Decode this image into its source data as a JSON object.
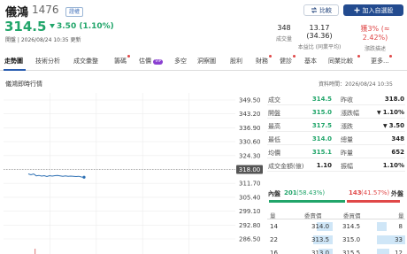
{
  "header": {
    "name": "儀鴻",
    "code": "1476",
    "market_badge": "證權",
    "price": "314.5",
    "change": "3.50 (1.10%)",
    "open_status": "開盤 | 2026/08/24 10:35 更新",
    "stats": [
      {
        "value": "348",
        "label": "成交量"
      },
      {
        "value": "13.17 (34.36)",
        "label": "本益比 (同業平均)"
      },
      {
        "value": "獲3% (≈ 2.42%)",
        "label": "漲跌描述"
      }
    ],
    "compare_label": "比較",
    "watch_label": "加入自選股",
    "colors": {
      "down": "#21a56a",
      "up": "#e04848",
      "brand": "#234b8f"
    }
  },
  "tabs": [
    "走勢圖",
    "技術分析",
    "成交彙整",
    "籌碼",
    "估價",
    "多空",
    "洞察圖",
    "股利",
    "財務",
    "健診",
    "基本",
    "同業比較",
    "更多..."
  ],
  "tab_vip_label": "VIP",
  "active_tab": "走勢圖",
  "section": {
    "title": "儀鴻即時行情",
    "data_time": "資料時間：2026/08/24 10:35"
  },
  "chart_data": {
    "type": "line",
    "title": "",
    "y_ticks": [
      349.5,
      343.2,
      336.9,
      330.6,
      324.3,
      318.0,
      311.7,
      305.4,
      299.1,
      292.8,
      286.5
    ],
    "ylim": [
      286.5,
      349.5
    ],
    "reference_price": 318.0,
    "reference_label": "318.00",
    "series": [
      {
        "values": [
          316.0,
          315.6,
          316.0,
          315.1,
          315.3,
          315.0,
          315.2,
          314.8,
          315.2,
          315.0,
          315.2,
          315.3,
          315.1,
          314.9,
          315.1,
          314.9,
          315.0,
          314.9,
          314.8,
          314.9,
          314.6,
          314.5
        ]
      }
    ],
    "volume_bar": {
      "index": 3,
      "value": 0.12
    },
    "grid": true
  },
  "stats_table": [
    {
      "k": "成交",
      "v": "314.5",
      "vc": "g",
      "k2": "昨收",
      "v2": "318.0",
      "v2c": "dk"
    },
    {
      "k": "開盤",
      "v": "315.0",
      "vc": "g",
      "k2": "漲跌幅",
      "v2": "1.10%",
      "v2c": "g",
      "arrow2": "down"
    },
    {
      "k": "最高",
      "v": "317.5",
      "vc": "g",
      "k2": "漲跌",
      "v2": "3.50",
      "v2c": "g",
      "arrow2": "down"
    },
    {
      "k": "最低",
      "v": "314.0",
      "vc": "g",
      "k2": "總量",
      "v2": "348",
      "v2c": "dk"
    },
    {
      "k": "均價",
      "v": "315.1",
      "vc": "g",
      "k2": "昨量",
      "v2": "652",
      "v2c": "dk"
    },
    {
      "k": "成交金額(億)",
      "v": "1.10",
      "vc": "dk",
      "k2": "振幅",
      "v2": "1.10%",
      "v2c": "dk"
    }
  ],
  "order_book": {
    "inner_label": "內盤",
    "inner_value": "201",
    "inner_pct": "(58.43%)",
    "inner_ratio": 0.5843,
    "outer_value": "143",
    "outer_pct": "(41.57%)",
    "outer_label": "外盤",
    "headers": [
      "量",
      "委賣價",
      "委買價",
      "量"
    ],
    "rows": [
      {
        "bid_qty": "14",
        "bid_price": "314.0",
        "ask_price": "314.5",
        "ask_qty": "8",
        "bid_level": 0.55,
        "ask_level": 0.35
      },
      {
        "bid_qty": "22",
        "bid_price": "313.5",
        "ask_price": "315.0",
        "ask_qty": "33",
        "bid_level": 0.7,
        "ask_level": 1.0
      },
      {
        "bid_qty": "16",
        "bid_price": "313.0",
        "ask_price": "315.5",
        "ask_qty": "12",
        "bid_level": 0.5,
        "ask_level": 0.45
      }
    ]
  }
}
